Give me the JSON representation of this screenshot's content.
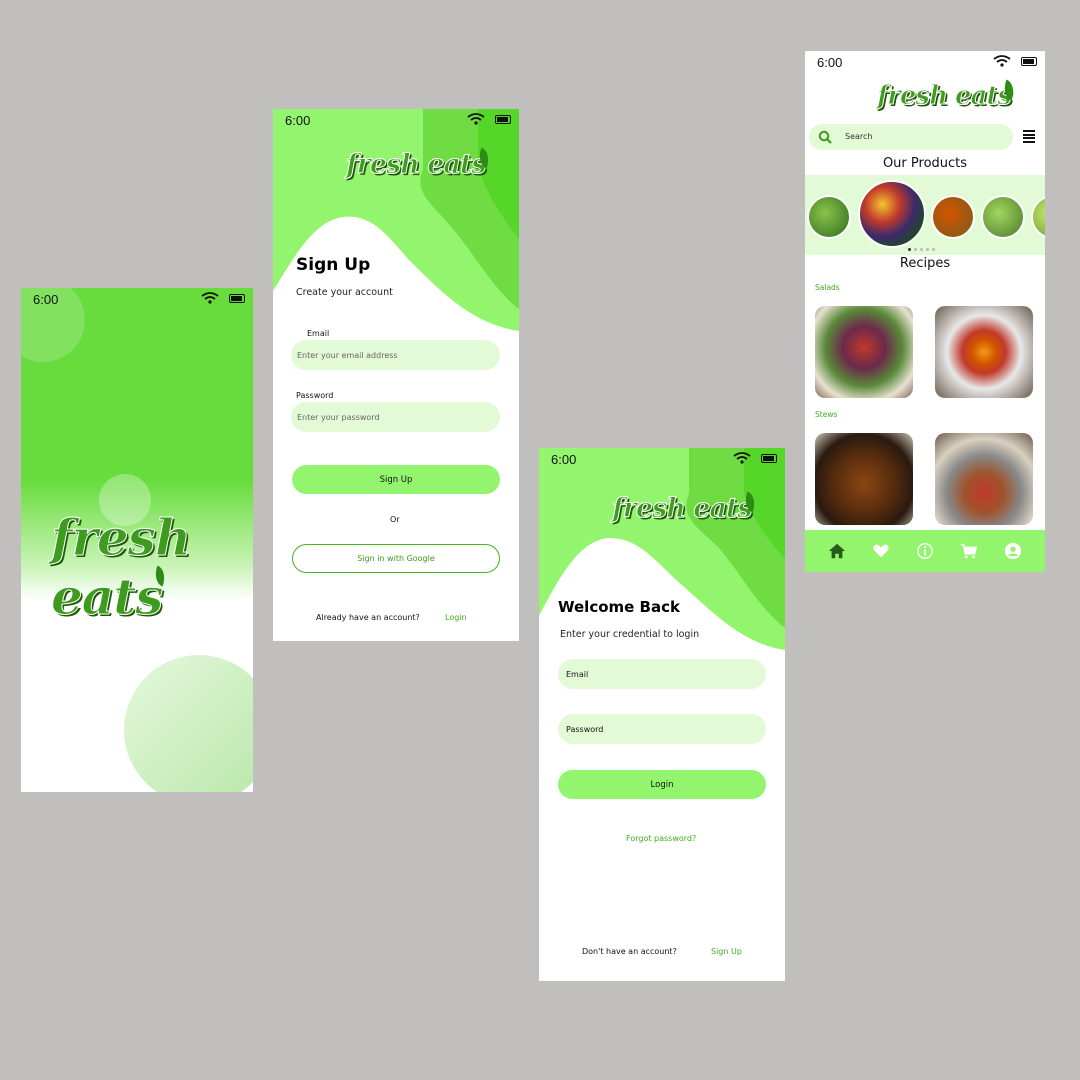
{
  "status": {
    "time": "6:00"
  },
  "brand": {
    "logo_text": "fresh eats"
  },
  "signup": {
    "title": "Sign Up",
    "subtitle": "Create your account",
    "email_label": "Email",
    "email_placeholder": "Enter your email address",
    "password_label": "Password",
    "password_placeholder": "Enter your password",
    "signup_button": "Sign Up",
    "or_text": "Or",
    "google_button": "Sign in with Google",
    "have_account": "Already have an account?",
    "login_link": "Login"
  },
  "login": {
    "title": "Welcome Back",
    "subtitle": "Enter your credential to login",
    "email_placeholder": "Email",
    "password_placeholder": "Password",
    "login_button": "Login",
    "forgot_link": "Forgot password?",
    "no_account": "Don't have an account?",
    "signup_link": "Sign Up"
  },
  "home": {
    "search_placeholder": "Search",
    "products_title": "Our Products",
    "recipes_title": "Recipes",
    "categories": [
      "Salads",
      "Stews"
    ],
    "nav_icons": [
      "home-icon",
      "heart-icon",
      "info-icon",
      "cart-icon",
      "profile-icon"
    ]
  },
  "colors": {
    "accent": "#93f56d",
    "accent_dark": "#67dc3c",
    "field_bg": "#e2fbd6",
    "link": "#3fae1e",
    "background": "#c0bfbd"
  }
}
